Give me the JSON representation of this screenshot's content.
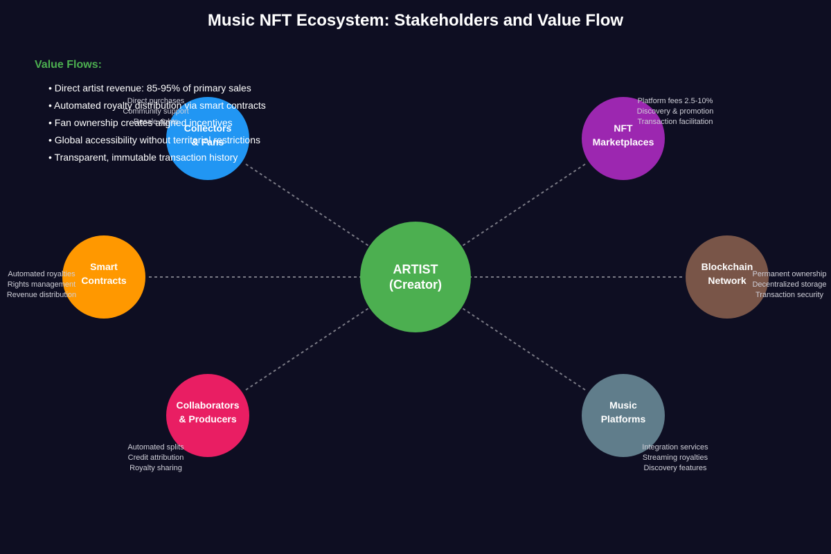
{
  "title": "Music NFT Ecosystem: Stakeholders and Value Flow",
  "colors": {
    "background": "#0e0e22",
    "artist": "#4caf50",
    "collectors": "#2196f3",
    "marketplaces": "#9c27b0",
    "smart_contracts": "#ff9800",
    "blockchain": "#795548",
    "collaborators": "#e91e63",
    "music_platforms": "#607d8b",
    "connector": "#7a7a85",
    "heading_accent": "#4caf50"
  },
  "center": {
    "line1": "ARTIST",
    "line2": "(Creator)"
  },
  "nodes": {
    "collectors": {
      "line1": "Collectors",
      "line2": "& Fans",
      "desc": [
        "Direct purchases",
        "Community support",
        "Resale rights"
      ]
    },
    "marketplaces": {
      "line1": "NFT",
      "line2": "Marketplaces",
      "desc": [
        "Platform fees 2.5-10%",
        "Discovery & promotion",
        "Transaction facilitation"
      ]
    },
    "smart_contracts": {
      "line1": "Smart",
      "line2": "Contracts",
      "desc": [
        "Automated royalties",
        "Rights management",
        "Revenue distribution"
      ]
    },
    "blockchain": {
      "line1": "Blockchain",
      "line2": "Network",
      "desc": [
        "Permanent ownership",
        "Decentralized storage",
        "Transaction security"
      ]
    },
    "collaborators": {
      "line1": "Collaborators",
      "line2": "& Producers",
      "desc": [
        "Automated splits",
        "Credit attribution",
        "Royalty sharing"
      ]
    },
    "music_platforms": {
      "line1": "Music",
      "line2": "Platforms",
      "desc": [
        "Integration services",
        "Streaming royalties",
        "Discovery features"
      ]
    }
  },
  "value_flows": {
    "heading": "Value Flows:",
    "items": [
      "• Direct artist revenue: 85-95% of primary sales",
      "• Automated royalty distribution via smart contracts",
      "• Fan ownership creates aligned incentives",
      "• Global accessibility without territorial restrictions",
      "• Transparent, immutable transaction history"
    ]
  }
}
